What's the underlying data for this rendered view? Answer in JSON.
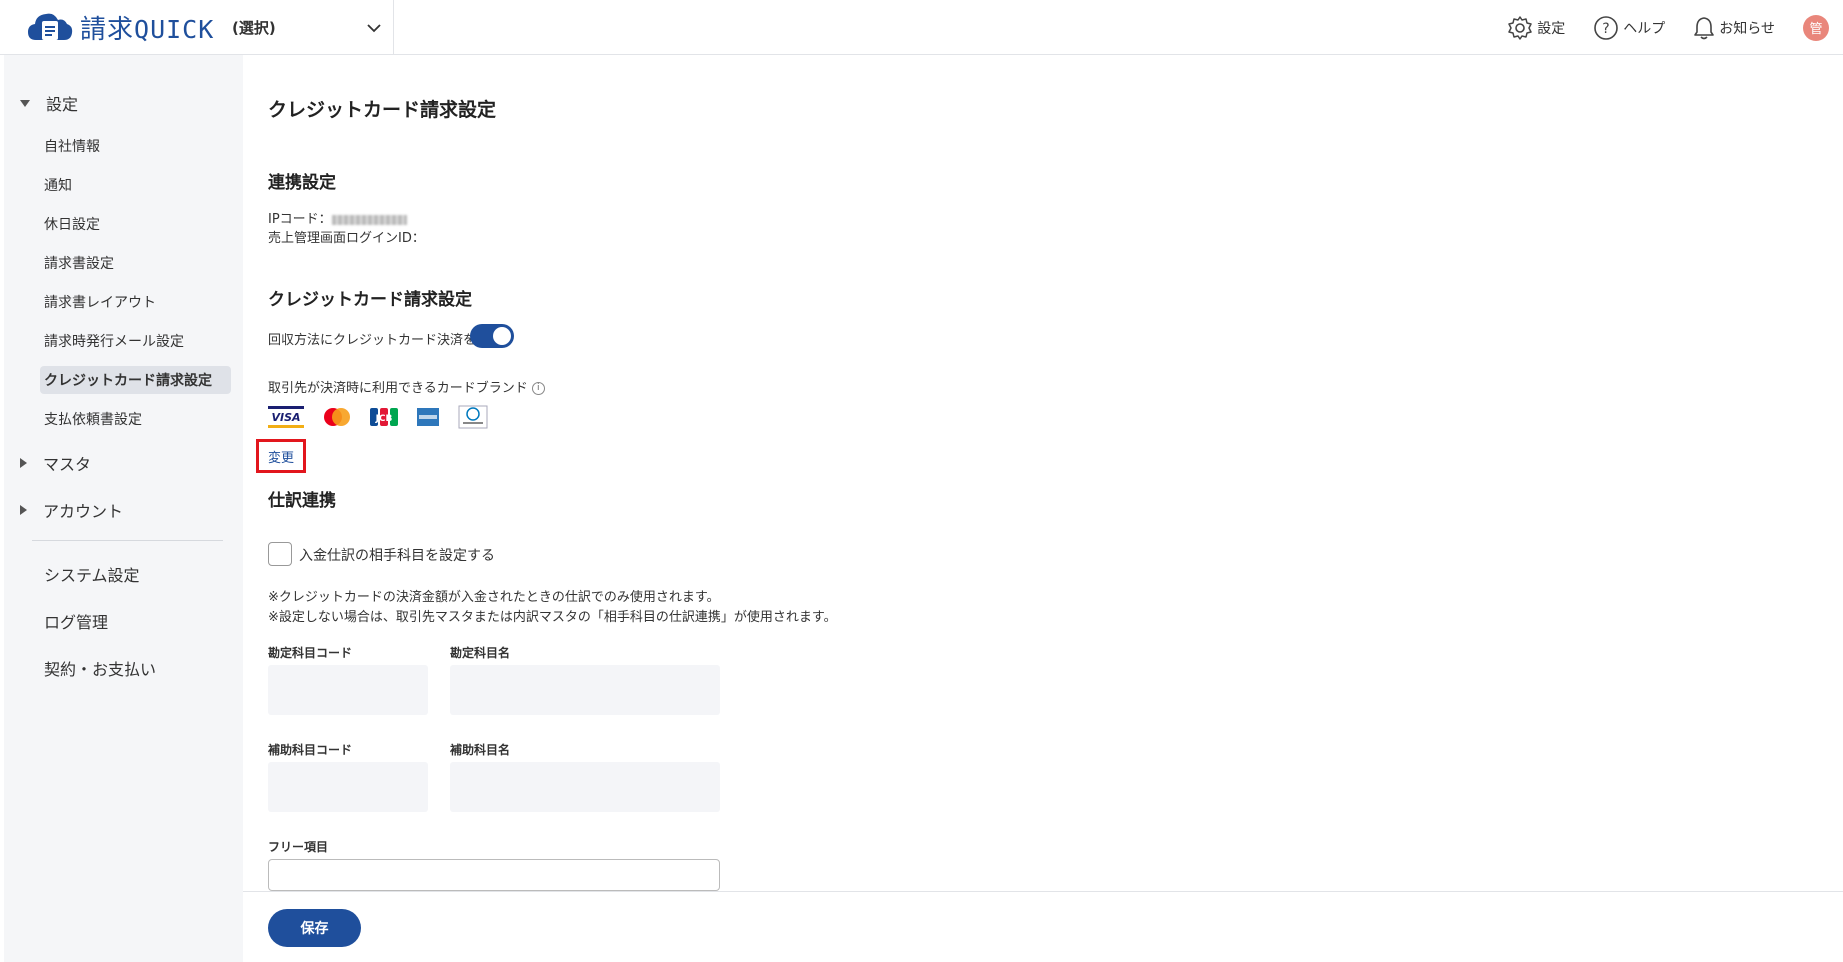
{
  "header": {
    "brand_name": "請求QUICK",
    "brand_prefix": "請求",
    "brand_suffix": "QUICK",
    "account_select": "(選択)",
    "settings": "設定",
    "help": "ヘルプ",
    "notifications": "お知らせ",
    "avatar": "管"
  },
  "sidebar": {
    "group_settings": "設定",
    "items": [
      "自社情報",
      "通知",
      "休日設定",
      "請求書設定",
      "請求書レイアウト",
      "請求時発行メール設定",
      "クレジットカード請求設定",
      "支払依頼書設定"
    ],
    "group_master": "マスタ",
    "group_account": "アカウント",
    "system": "システム設定",
    "logs": "ログ管理",
    "contract": "契約・お支払い"
  },
  "main": {
    "title": "クレジットカード請求設定",
    "link_section": "連携設定",
    "ip_code_label": "IPコード：",
    "sales_login_label": "売上管理画面ログインID：",
    "cc_section": "クレジットカード請求設定",
    "toggle_label": "回収方法にクレジットカード決済を追加",
    "toggle_on": true,
    "brands_label": "取引先が決済時に利用できるカードブランド",
    "brands": [
      "VISA",
      "Mastercard",
      "JCB",
      "American Express",
      "Diners Club"
    ],
    "change_link": "変更",
    "journal_section": "仕訳連携",
    "journal_checkbox": "入金仕訳の相手科目を設定する",
    "note1": "※クレジットカードの決済金額が入金されたときの仕訳でのみ使用されます。",
    "note2": "※設定しない場合は、取引先マスタまたは内訳マスタの「相手科目の仕訳連携」が使用されます。",
    "account_code_label": "勘定科目コード",
    "account_name_label": "勘定科目名",
    "sub_code_label": "補助科目コード",
    "sub_name_label": "補助科目名",
    "free_label": "フリー項目"
  },
  "footer": {
    "save": "保存"
  },
  "colors": {
    "primary": "#1f4f9c",
    "highlight": "#e2161d",
    "avatar": "#e9867b"
  }
}
